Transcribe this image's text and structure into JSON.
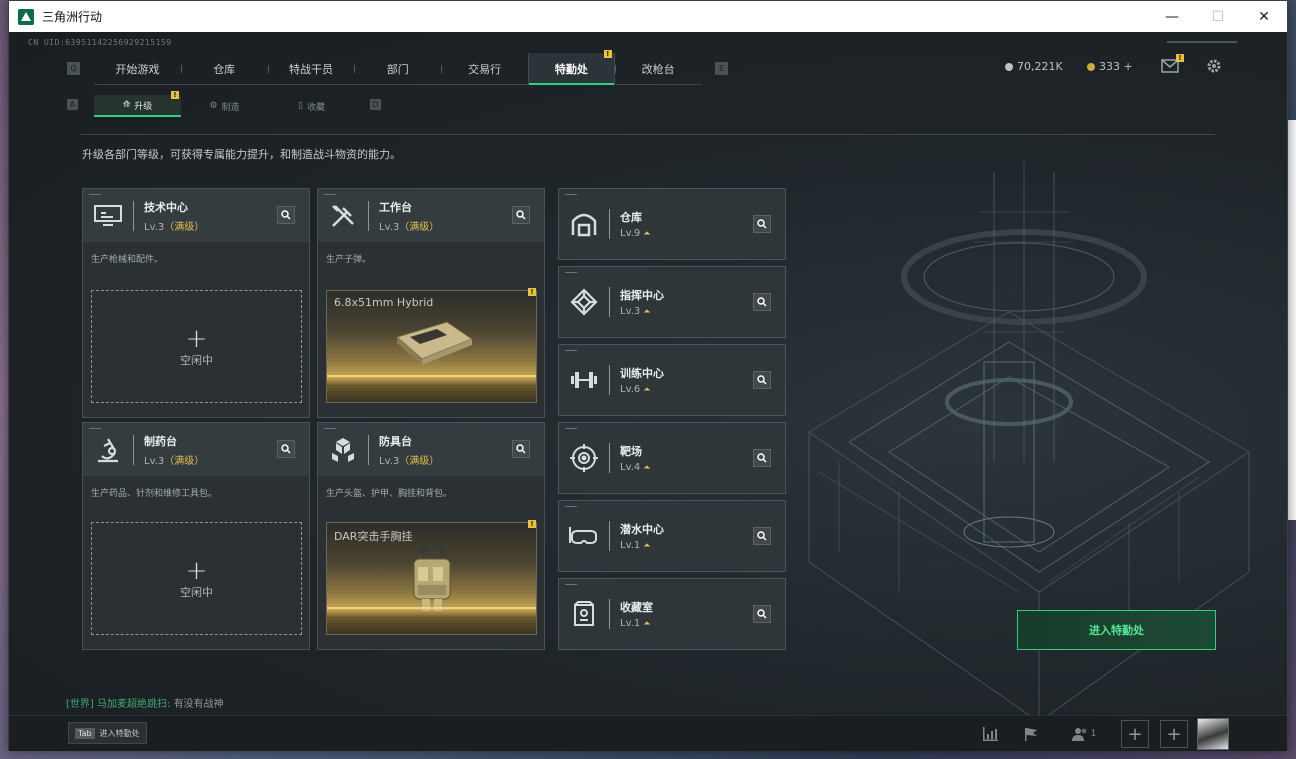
{
  "window": {
    "title": "三角洲行动",
    "min": "—",
    "max": "☐",
    "close": "✕"
  },
  "uid": "CN UID:6395114225692921515​9",
  "main_nav": {
    "left_key": "Q",
    "right_key": "E",
    "items": [
      "开始游戏",
      "仓库",
      "特战干员",
      "部门",
      "交易行",
      "特勤处",
      "改枪台"
    ],
    "active_index": 5,
    "badge": "!"
  },
  "currency": {
    "silver": "70,221K",
    "gold": "333 +"
  },
  "sub_nav": {
    "left_key": "A",
    "right_key": "D",
    "items": [
      "升级",
      "制造",
      "收藏"
    ],
    "active_index": 0,
    "badge": "!"
  },
  "description": "升级各部门等级，可获得专属能力提升，和制造战斗物资的能力。",
  "big_cards": [
    {
      "name": "技术中心",
      "level": "Lv.3",
      "max": "（满级）",
      "desc": "生产枪械和配件。",
      "slot": "empty",
      "icon": "monitor-icon"
    },
    {
      "name": "工作台",
      "level": "Lv.3",
      "max": "（满级）",
      "desc": "生产子弹。",
      "slot": "item",
      "item_name": "6.8x51mm Hybrid",
      "badge": "!",
      "icon": "tools-icon"
    },
    {
      "name": "制药台",
      "level": "Lv.3",
      "max": "（满级）",
      "desc": "生产药品、针剂和维修工具包。",
      "slot": "empty",
      "icon": "microscope-icon"
    },
    {
      "name": "防具台",
      "level": "Lv.3",
      "max": "（满级）",
      "desc": "生产头盔、护甲、胸挂和背包。",
      "slot": "item",
      "item_name": "DAR突击手胸挂",
      "badge": "!",
      "icon": "cubes-icon"
    }
  ],
  "empty_label": "空闲中",
  "empty_plus": "+",
  "small_cards": [
    {
      "name": "仓库",
      "level": "Lv.9",
      "icon": "warehouse-icon"
    },
    {
      "name": "指挥中心",
      "level": "Lv.3",
      "icon": "command-icon"
    },
    {
      "name": "训练中心",
      "level": "Lv.6",
      "icon": "dumbbell-icon"
    },
    {
      "name": "靶场",
      "level": "Lv.4",
      "icon": "target-icon"
    },
    {
      "name": "潜水中心",
      "level": "Lv.1",
      "icon": "goggles-icon"
    },
    {
      "name": "收藏室",
      "level": "Lv.1",
      "icon": "vault-icon"
    }
  ],
  "enter_button": "进入特勤处",
  "chat": {
    "channel": "[世界]",
    "user": "马加麦超绝跳扫:",
    "message": "有没有战神"
  },
  "bottom": {
    "tab_key": "Tab",
    "tab_label": "进入特勤处",
    "friends": "1",
    "slot_plus": "+"
  },
  "colors": {
    "accent": "#2fd17e",
    "gold": "#e2be4e",
    "badge": "#e8c23c"
  }
}
